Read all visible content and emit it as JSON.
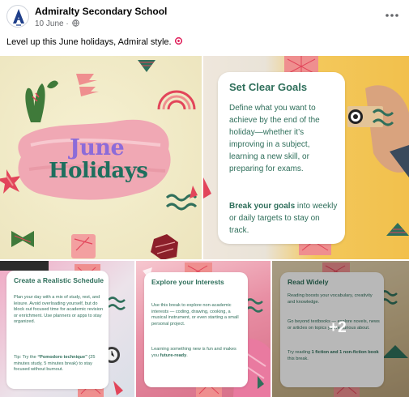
{
  "post": {
    "page_name": "Admiralty Secondary School",
    "date": "10 June",
    "caption": "Level up this June holidays, Admiral style."
  },
  "tiles": {
    "tile1": {
      "line1": "June",
      "line2": "Holidays"
    },
    "tile2": {
      "title": "Set Clear Goals",
      "body": "Define what you want to achieve by the end of the holiday—whether it’s improving in a subject, learning a new skill, or preparing for exams.",
      "body2_bold": "Break your goals",
      "body2_rest": " into weekly or daily targets to stay on track."
    },
    "tile3": {
      "title": "Create a Realistic Schedule",
      "body": "Plan your day with a mix of study, rest, and leisure. Avoid overloading yourself, but do block out focused time for academic revision or enrichment. Use planners or apps to stay organized.",
      "tip_prefix": "Tip: Try the ",
      "tip_bold": "“Pomodoro technique”",
      "tip_rest": " (25 minutes study, 5 minutes break) to stay focused without burnout."
    },
    "tile4": {
      "title": "Explore your Interests",
      "body": "Use this break to explore non-academic interests — coding, drawing, cooking, a musical instrument, or even starting a small personal project.",
      "body2_prefix": "Learning something new is fun and makes you ",
      "body2_bold": "future-ready",
      "body2_suffix": "."
    },
    "tile5": {
      "title": "Read Widely",
      "body": "Reading boosts your vocabulary, creativity and knowledge.",
      "body2": "Go beyond textbooks — explore novels, news or articles on topics you're curious about.",
      "body3_prefix": "Try reading ",
      "body3_bold": "1 fiction and 1 non-fiction book",
      "body3_suffix": " this break.",
      "more_count": "+2"
    }
  },
  "colors": {
    "accent_green": "#2f6f5b",
    "june_purple": "#8c6bd9",
    "holidays_green": "#1f6f5e",
    "pink": "#ef8f8f",
    "red": "#e2455a"
  },
  "icons": [
    "school-crest-icon",
    "globe-icon",
    "more-options-icon",
    "target-emoji-icon"
  ]
}
